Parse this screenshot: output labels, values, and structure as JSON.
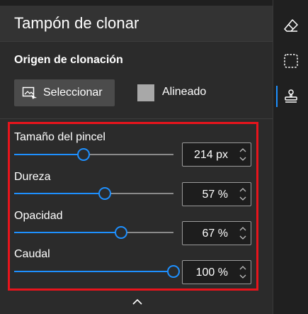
{
  "panel": {
    "title": "Tampón de clonar",
    "source_section": {
      "label": "Origen de clonación",
      "select_button": "Seleccionar",
      "aligned_checkbox": {
        "label": "Alineado",
        "checked": false
      }
    },
    "sliders": [
      {
        "label": "Tamaño del pincel",
        "value_text": "214 px",
        "level": 0.435
      },
      {
        "label": "Dureza",
        "value_text": "57 %",
        "level": 0.57
      },
      {
        "label": "Opacidad",
        "value_text": "67 %",
        "level": 0.67
      },
      {
        "label": "Caudal",
        "value_text": "100 %",
        "level": 1.0
      }
    ],
    "collapse_icon": "chevron-up-icon"
  },
  "toolbar": {
    "tools": [
      {
        "icon": "eraser-icon",
        "active": false
      },
      {
        "icon": "selection-icon",
        "active": false
      },
      {
        "icon": "clone-stamp-icon",
        "active": true
      }
    ]
  },
  "colors": {
    "accent": "#1e90ff",
    "highlight_box": "#e8141c",
    "panel_bg": "#2b2b2b",
    "header_bg": "#333333"
  }
}
